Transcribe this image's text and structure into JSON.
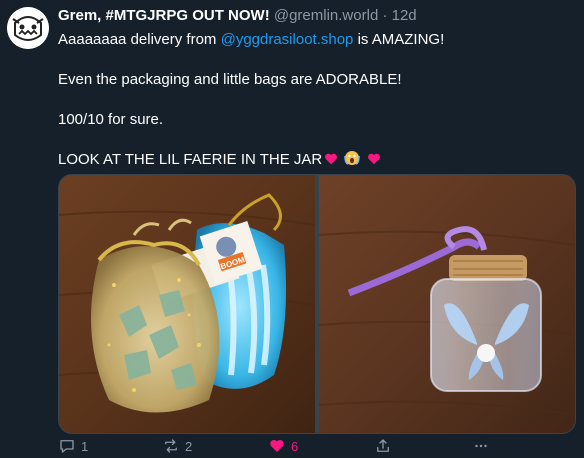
{
  "tweet": {
    "display_name": "Grem, #MTGJRPG OUT NOW!",
    "handle": "@gremlin.world",
    "separator": "·",
    "timestamp": "12d",
    "line1_prefix": "Aaaaaaaa delivery from ",
    "line1_mention": "@yggdrasiloot.shop",
    "line1_suffix": " is AMAZING!",
    "line2": "Even the packaging and little bags are ADORABLE!",
    "line3": "100/10 for sure.",
    "line4": "LOOK AT THE LIL FAERIE IN THE JAR",
    "emoji_after_line4": [
      "heart",
      "screaming-face",
      "heart"
    ]
  },
  "media": {
    "count": 2,
    "photo1_content": [
      "organza-dice-bag-gold",
      "organza-dice-bag-blue"
    ],
    "photo1_tag_text": "BOOM",
    "photo2_content": "glass-jar-faerie-cork-purple-ribbon"
  },
  "actions": {
    "replies": "1",
    "reposts": "2",
    "likes": "6",
    "liked": true,
    "share_icon": "share-icon",
    "more_icon": "more-icon"
  },
  "colors": {
    "background": "#15202b",
    "text": "#ffffff",
    "secondary": "#8b98a5",
    "link": "#1d9bf0",
    "like": "#f91880"
  }
}
